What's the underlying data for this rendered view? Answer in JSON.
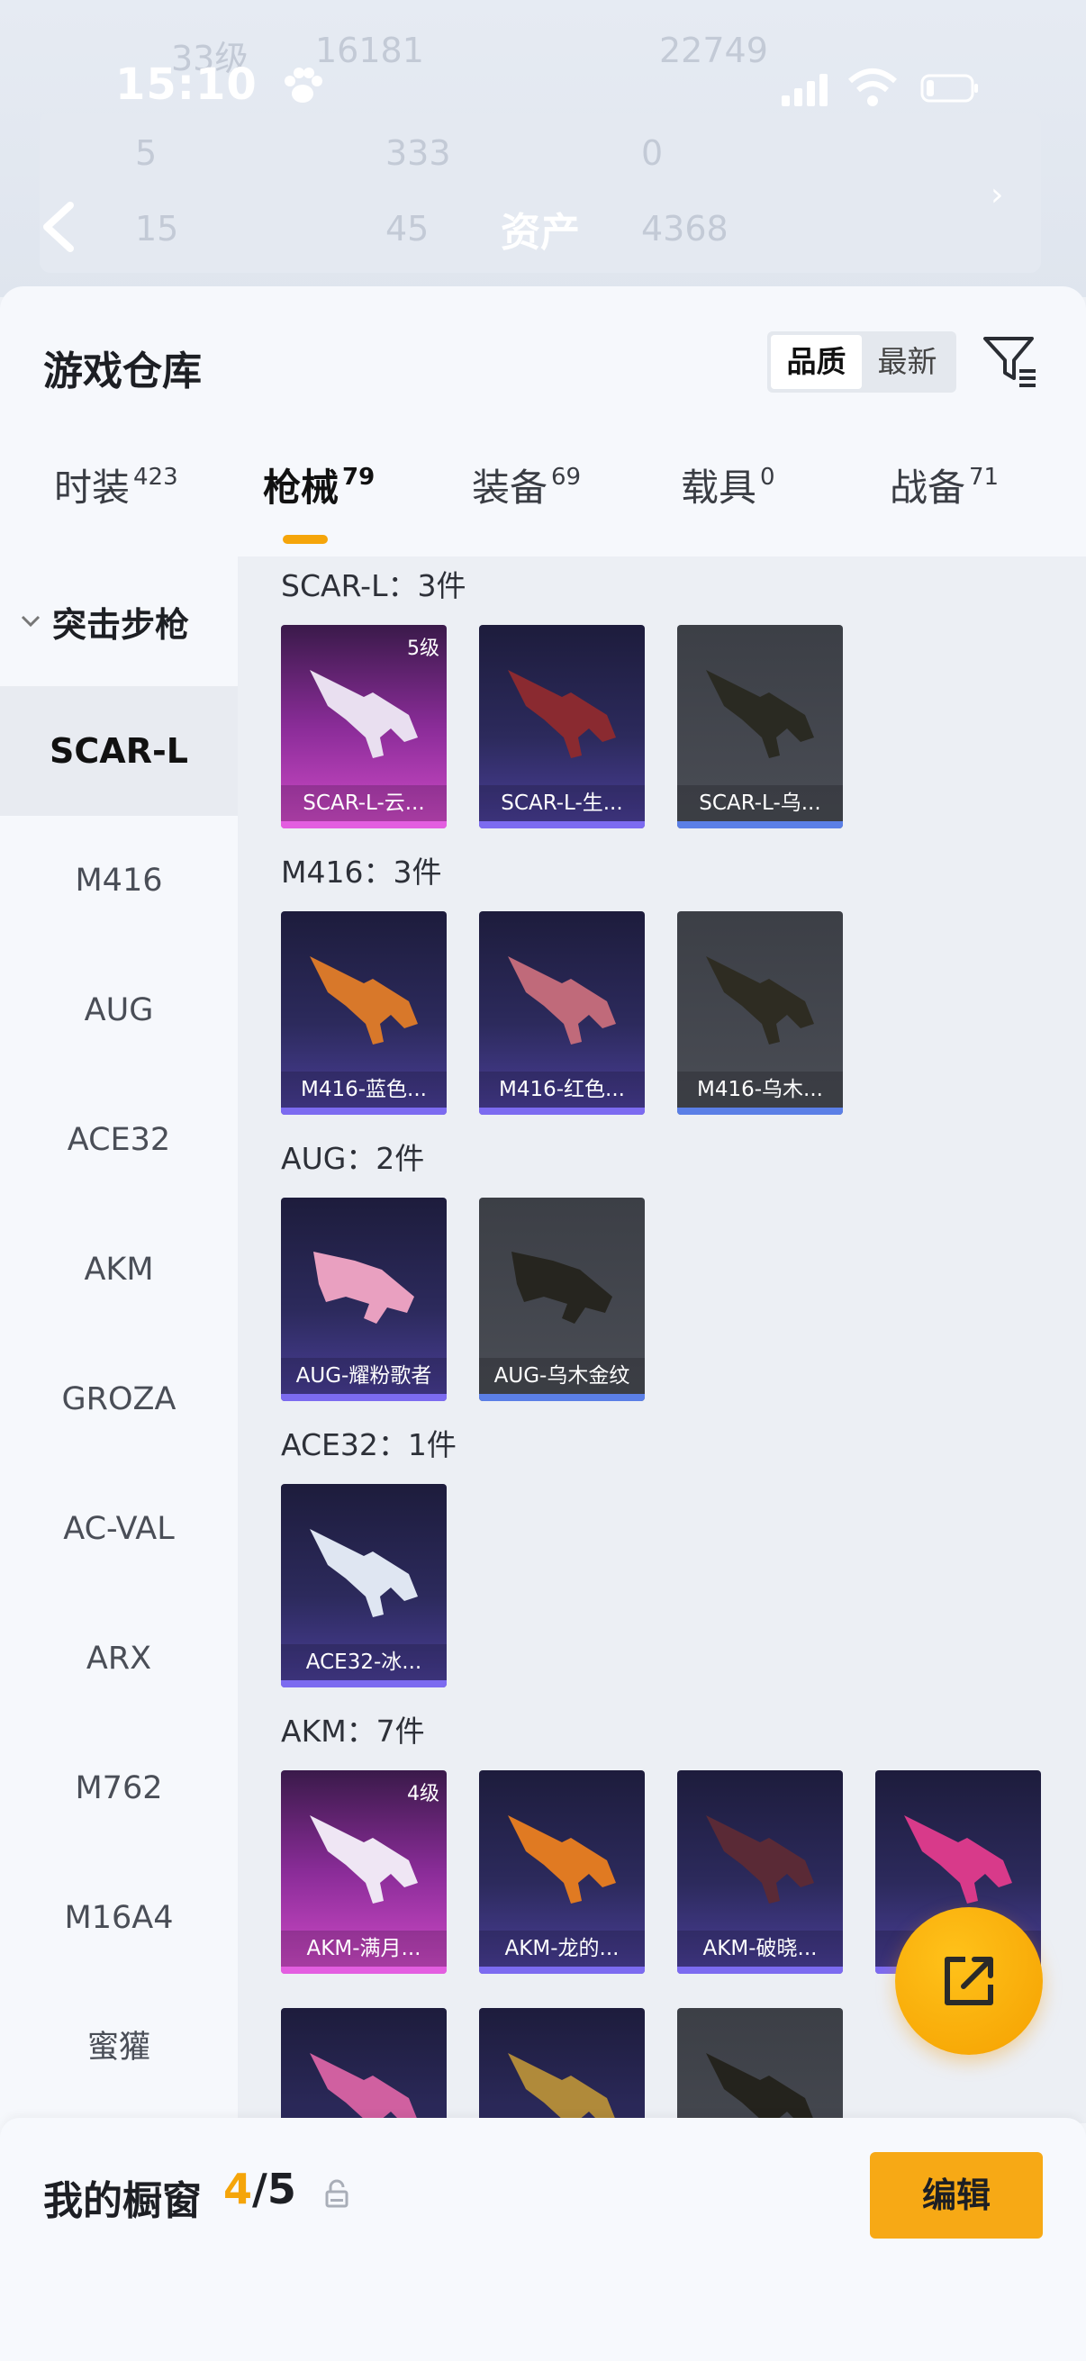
{
  "status_bar": {
    "time": "15:10"
  },
  "background_header": {
    "title": "资产",
    "blur_numbers": [
      "33级",
      "16181",
      "22749",
      "5",
      "333",
      "0",
      "15",
      "45",
      "4368"
    ]
  },
  "sheet": {
    "title": "游戏仓库",
    "sort": {
      "options": [
        "品质",
        "最新"
      ],
      "active": "品质"
    }
  },
  "tabs": [
    {
      "label": "时装",
      "count": "423"
    },
    {
      "label": "枪械",
      "count": "79",
      "active": true
    },
    {
      "label": "装备",
      "count": "69"
    },
    {
      "label": "载具",
      "count": "0"
    },
    {
      "label": "战备",
      "count": "71"
    }
  ],
  "sidebar": {
    "category": "突击步枪",
    "items": [
      "SCAR-L",
      "M416",
      "AUG",
      "ACE32",
      "AKM",
      "GROZA",
      "AC-VAL",
      "ARX",
      "M762",
      "M16A4",
      "蜜獾"
    ],
    "active": "SCAR-L"
  },
  "groups": [
    {
      "title": "SCAR-L：3件",
      "items": [
        {
          "name": "SCAR-L-云...",
          "rarity": "pink",
          "level": "5级"
        },
        {
          "name": "SCAR-L-生...",
          "rarity": "purple"
        },
        {
          "name": "SCAR-L-乌...",
          "rarity": "gray"
        }
      ]
    },
    {
      "title": "M416：3件",
      "items": [
        {
          "name": "M416-蓝色...",
          "rarity": "purple"
        },
        {
          "name": "M416-红色...",
          "rarity": "purple"
        },
        {
          "name": "M416-乌木...",
          "rarity": "gray"
        }
      ]
    },
    {
      "title": "AUG：2件",
      "items": [
        {
          "name": "AUG-耀粉歌者",
          "rarity": "purple"
        },
        {
          "name": "AUG-乌木金纹",
          "rarity": "gray"
        }
      ]
    },
    {
      "title": "ACE32：1件",
      "items": [
        {
          "name": "ACE32-冰...",
          "rarity": "purple"
        }
      ]
    },
    {
      "title": "AKM：7件",
      "items": [
        {
          "name": "AKM-满月...",
          "rarity": "pink",
          "level": "4级"
        },
        {
          "name": "AKM-龙的...",
          "rarity": "purple"
        },
        {
          "name": "AKM-破晓...",
          "rarity": "purple"
        },
        {
          "name": "A",
          "rarity": "purple"
        },
        {
          "name": "",
          "rarity": "purple"
        },
        {
          "name": "",
          "rarity": "purple"
        },
        {
          "name": "",
          "rarity": "gray"
        }
      ]
    }
  ],
  "bottom_bar": {
    "title": "我的橱窗",
    "count_current": "4",
    "count_total": "/5",
    "edit_label": "编辑"
  },
  "colors": {
    "accent": "#f5a50a",
    "purple_bar": "#7c6bf0",
    "pink_bar": "#e35ee0",
    "gray_bar": "#5b7fe6"
  }
}
